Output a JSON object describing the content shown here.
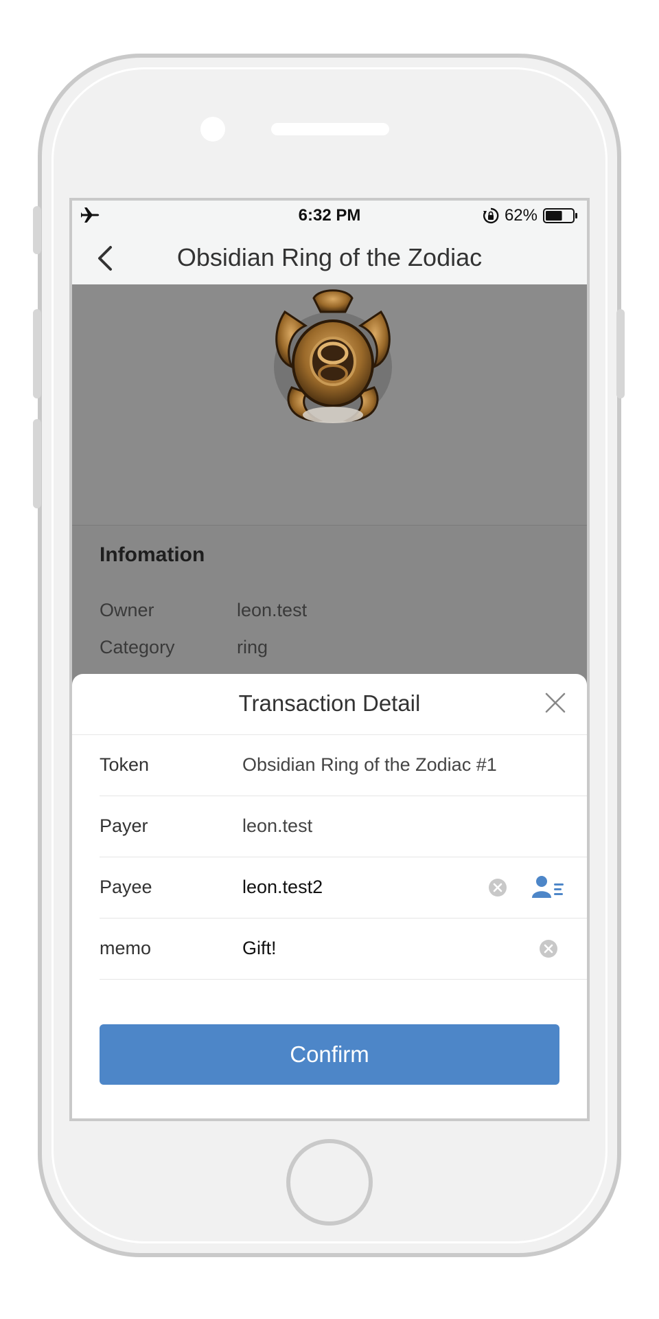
{
  "status_bar": {
    "mode_icon": "airplane-icon",
    "time": "6:32 PM",
    "rotation_lock_icon": "rotation-lock-icon",
    "battery_percent": "62%",
    "battery_level": 0.62
  },
  "nav": {
    "title": "Obsidian Ring of the Zodiac",
    "back_icon": "chevron-left-icon"
  },
  "info": {
    "heading": "Infomation",
    "rows": [
      {
        "label": "Owner",
        "value": "leon.test"
      },
      {
        "label": "Category",
        "value": "ring"
      }
    ]
  },
  "sheet": {
    "title": "Transaction Detail",
    "close_icon": "close-icon",
    "fields": {
      "token": {
        "label": "Token",
        "value": "Obsidian Ring of the Zodiac #1"
      },
      "payer": {
        "label": "Payer",
        "value": "leon.test"
      },
      "payee": {
        "label": "Payee",
        "value": "leon.test2"
      },
      "memo": {
        "label": "memo",
        "value": "Gift!"
      }
    },
    "confirm_label": "Confirm"
  },
  "colors": {
    "accent": "#4d86c8",
    "overlay": "#888888"
  }
}
